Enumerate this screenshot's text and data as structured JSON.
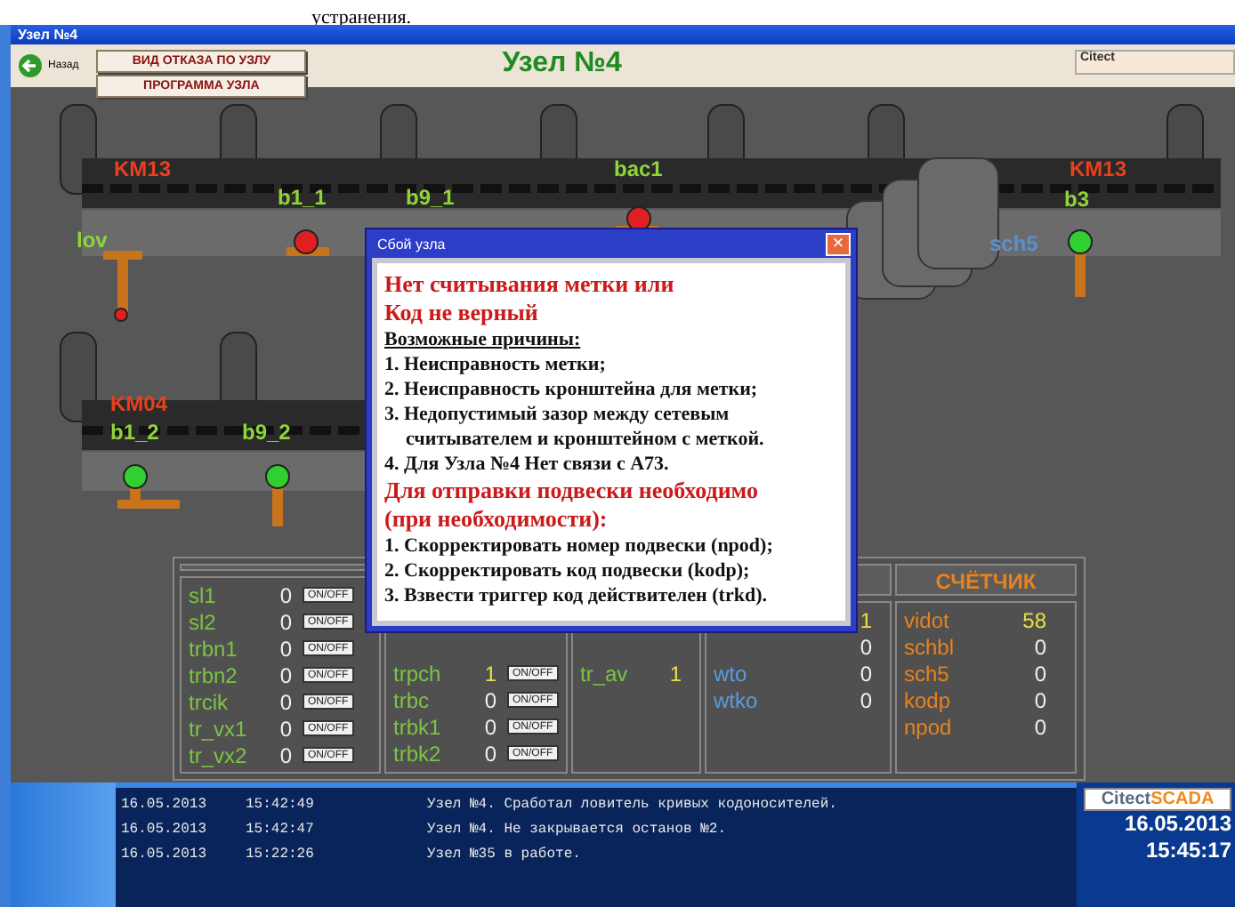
{
  "page_text": "устранения.",
  "window": {
    "title": "Узел №4"
  },
  "toolbar": {
    "back": "Назад",
    "buttons": [
      "ВИД ОТКАЗА ПО УЗЛУ",
      "ПРОГРАММА УЗЛА"
    ],
    "heading": "Узел №4",
    "citect_field": "Citect"
  },
  "scene": {
    "labels": [
      {
        "text": "KM13",
        "color": "#e8401c"
      },
      {
        "text": "b1_1",
        "color": "#8fd43a"
      },
      {
        "text": "b9_1",
        "color": "#8fd43a"
      },
      {
        "text": "bac1",
        "color": "#8fd43a"
      },
      {
        "text": "KM13",
        "color": "#e8401c"
      },
      {
        "text": "b3",
        "color": "#8fd43a"
      },
      {
        "text": "lov",
        "color": "#8fd43a"
      },
      {
        "text": "sch5",
        "color": "#5c8fd0"
      },
      {
        "text": "KM04",
        "color": "#e8401c"
      },
      {
        "text": "b1_2",
        "color": "#8fd43a"
      },
      {
        "text": "b9_2",
        "color": "#8fd43a"
      }
    ],
    "lamps": [
      {
        "color": "#e02020"
      },
      {
        "color": "#e02020"
      },
      {
        "color": "#30d030"
      },
      {
        "color": "#e02020"
      },
      {
        "color": "#30d030"
      },
      {
        "color": "#30d030"
      }
    ]
  },
  "dialog": {
    "title": "Сбой узла",
    "close": "×",
    "lines": [
      {
        "kind": "alert",
        "text": "Нет считывания метки или"
      },
      {
        "kind": "alert",
        "text": "Код не верный"
      },
      {
        "kind": "heading",
        "text": "Возможные причины:"
      },
      {
        "kind": "item",
        "text": "1. Неисправность метки;"
      },
      {
        "kind": "item",
        "text": "2. Неисправность кронштейна для метки;"
      },
      {
        "kind": "item",
        "text": "3. Недопустимый зазор между сетевым"
      },
      {
        "kind": "indent",
        "text": "считывателем и кронштейном с меткой."
      },
      {
        "kind": "item",
        "text": "4. Для Узла №4 Нет связи с А73."
      },
      {
        "kind": "alert",
        "text": "Для отправки подвески необходимо"
      },
      {
        "kind": "alert",
        "text": "(при необходимости):"
      },
      {
        "kind": "item",
        "text": "1. Скорректировать номер подвески (npod);"
      },
      {
        "kind": "item",
        "text": "2. Скорректировать код подвески (kodp);"
      },
      {
        "kind": "item",
        "text": "3. Взвести триггер код действителен (trkd)."
      }
    ]
  },
  "panels": [
    {
      "color": "#7cc444",
      "rows": [
        {
          "label": "sl1",
          "value": "0",
          "highlight": false,
          "button": "ON/OFF"
        },
        {
          "label": "sl2",
          "value": "0",
          "highlight": false,
          "button": "ON/OFF"
        },
        {
          "label": "trbn1",
          "value": "0",
          "highlight": false,
          "button": "ON/OFF"
        },
        {
          "label": "trbn2",
          "value": "0",
          "highlight": false,
          "button": "ON/OFF"
        },
        {
          "label": "trcik",
          "value": "0",
          "highlight": false,
          "button": "ON/OFF"
        },
        {
          "label": "tr_vx1",
          "value": "0",
          "highlight": false,
          "button": "ON/OFF"
        },
        {
          "label": "tr_vx2",
          "value": "0",
          "highlight": false,
          "button": "ON/OFF"
        }
      ]
    },
    {
      "color": "#7cc444",
      "rows": [
        {
          "label": "trpch",
          "value": "1",
          "highlight": true,
          "button": "ON/OFF"
        },
        {
          "label": "trbc",
          "value": "0",
          "highlight": false,
          "button": "ON/OFF"
        },
        {
          "label": "trbk1",
          "value": "0",
          "highlight": false,
          "button": "ON/OFF"
        },
        {
          "label": "trbk2",
          "value": "0",
          "highlight": false,
          "button": "ON/OFF"
        }
      ]
    },
    {
      "color": "#7cc444",
      "rows": [
        {
          "label": "tr_av",
          "value": "1",
          "highlight": true
        }
      ]
    },
    {
      "color": "#5c9ae0",
      "rows": [
        {
          "value": "1",
          "highlight": true
        },
        {
          "value": "0",
          "highlight": false
        },
        {
          "label": "wto",
          "value": "0",
          "highlight": false
        },
        {
          "label": "wtko",
          "value": "0",
          "highlight": false
        }
      ]
    },
    {
      "color": "#e8821c",
      "header": "СЧЁТЧИК",
      "rows": [
        {
          "label": "vidot",
          "value": "58",
          "highlight": true
        },
        {
          "label": "schbl",
          "value": "0",
          "highlight": false
        },
        {
          "label": "sch5",
          "value": "0",
          "highlight": false
        },
        {
          "label": "kodp",
          "value": "0",
          "highlight": false
        },
        {
          "label": "npod",
          "value": "0",
          "highlight": false
        }
      ]
    }
  ],
  "alarms": [
    {
      "date": "16.05.2013",
      "time": "15:42:49",
      "message": "Узел №4. Сработал ловитель кривых кодоносителей."
    },
    {
      "date": "16.05.2013",
      "time": "15:42:47",
      "message": "Узел №4. Не закрывается останов №2."
    },
    {
      "date": "16.05.2013",
      "time": "15:22:26",
      "message": "Узел №35 в работе."
    }
  ],
  "status": {
    "logo_a": "Citect",
    "logo_b": "SCADA",
    "date": "16.05.2013",
    "time": "15:45:17"
  }
}
